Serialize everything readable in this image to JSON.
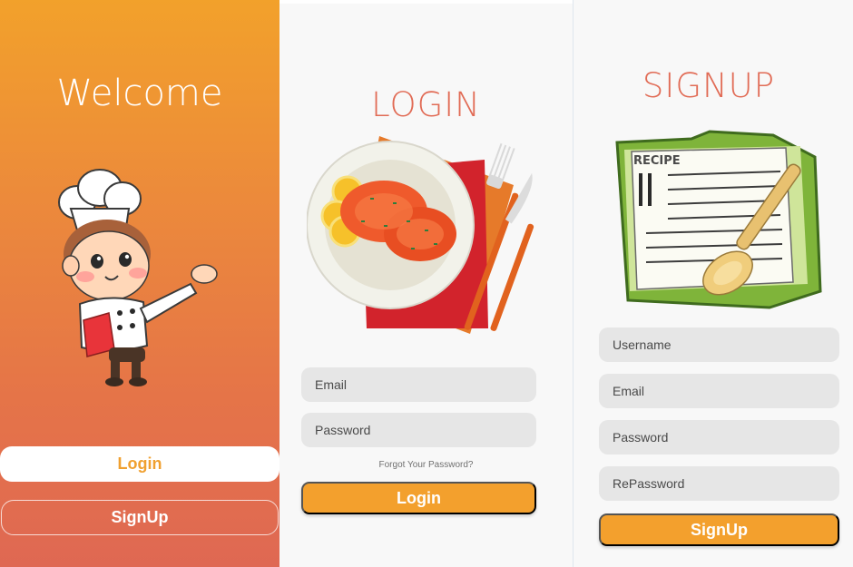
{
  "welcome": {
    "title": "Welcome",
    "login_label": "Login",
    "signup_label": "SignUp"
  },
  "login": {
    "title": "LOGIN",
    "email_placeholder": "Email",
    "password_placeholder": "Password",
    "forgot_label": "Forgot Your Password?",
    "login_label": "Login"
  },
  "signup": {
    "title": "SIGNUP",
    "recipe_card_text": "RECIPE",
    "username_placeholder": "Username",
    "email_placeholder": "Email",
    "password_placeholder": "Password",
    "repassword_placeholder": "RePassword",
    "signup_label": "SignUp"
  },
  "colors": {
    "accent_orange": "#f3a02d",
    "title_coral": "#e16b55",
    "gradient_top": "#f2a12b",
    "gradient_bottom": "#df6853"
  },
  "icons": [
    "chef-illustration",
    "food-plate-illustration",
    "recipe-card-illustration"
  ]
}
